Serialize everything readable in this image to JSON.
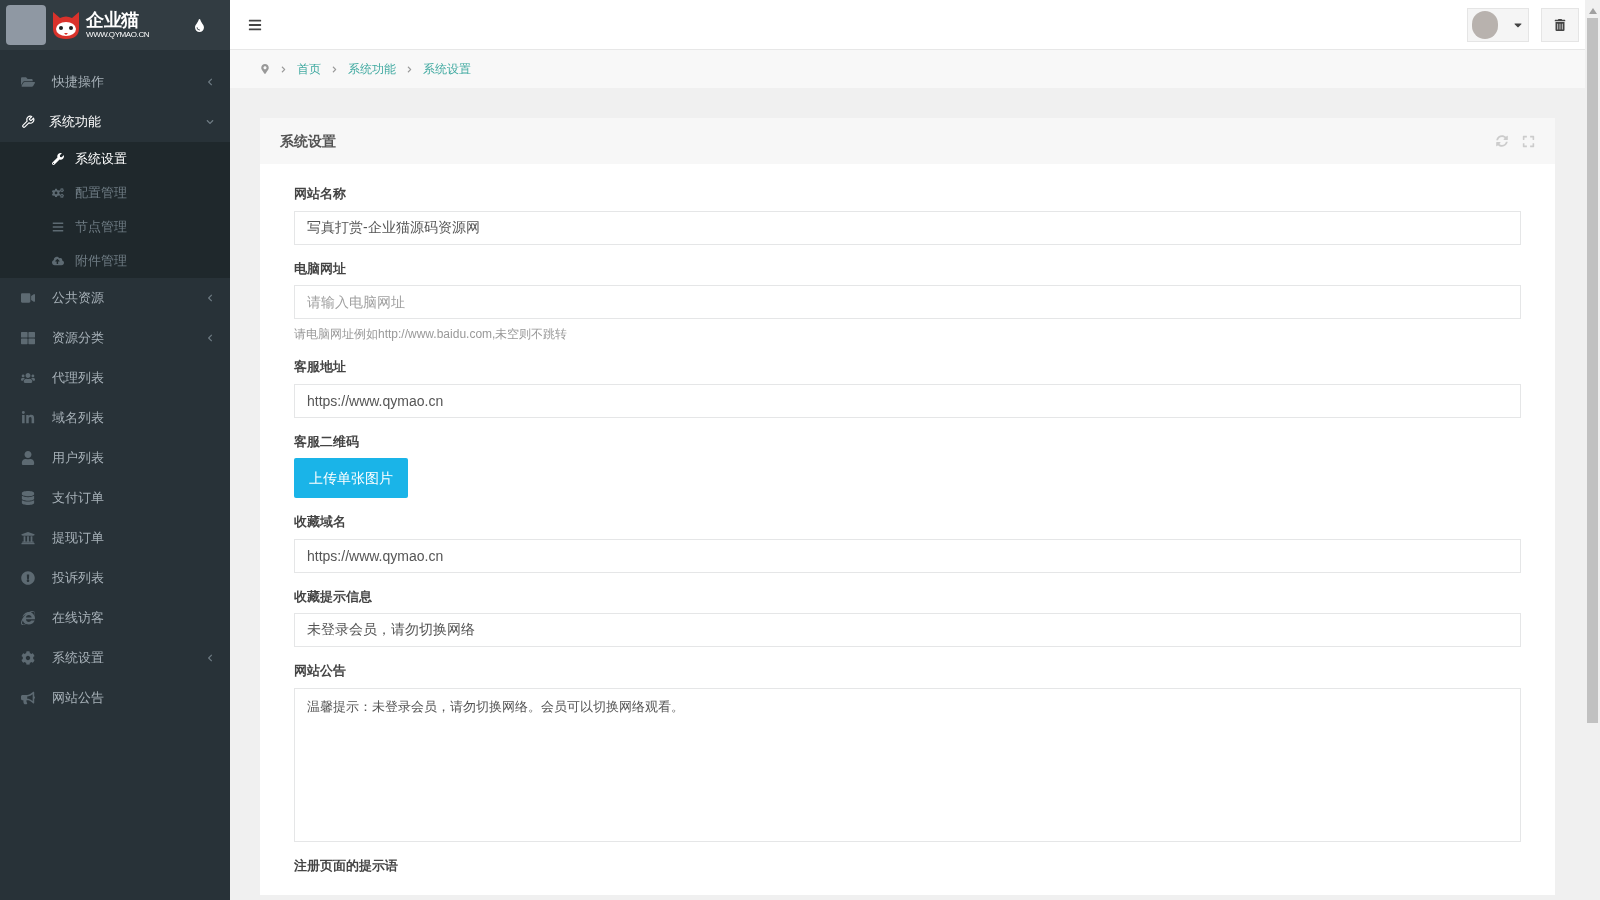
{
  "brand": {
    "name": "企业猫",
    "url": "WWW.QYMAO.CN"
  },
  "sidebar": {
    "items": [
      {
        "label": "快捷操作",
        "expanded": false
      },
      {
        "label": "系统功能",
        "expanded": true,
        "children": [
          {
            "label": "系统设置",
            "selected": true
          },
          {
            "label": "配置管理",
            "selected": false
          },
          {
            "label": "节点管理",
            "selected": false
          },
          {
            "label": "附件管理",
            "selected": false
          }
        ]
      },
      {
        "label": "公共资源",
        "expanded": false
      },
      {
        "label": "资源分类",
        "expanded": false
      },
      {
        "label": "代理列表"
      },
      {
        "label": "域名列表"
      },
      {
        "label": "用户列表"
      },
      {
        "label": "支付订单"
      },
      {
        "label": "提现订单"
      },
      {
        "label": "投诉列表"
      },
      {
        "label": "在线访客"
      },
      {
        "label": "系统设置",
        "expanded": false
      },
      {
        "label": "网站公告"
      }
    ]
  },
  "breadcrumb": [
    "首页",
    "系统功能",
    "系统设置"
  ],
  "card": {
    "title": "系统设置",
    "fields": [
      {
        "kind": "input",
        "label": "网站名称",
        "value": "写真打赏-企业猫源码资源网"
      },
      {
        "kind": "input",
        "label": "电脑网址",
        "placeholder": "请输入电脑网址",
        "help": "请电脑网址例如http://www.baidu.com,未空则不跳转"
      },
      {
        "kind": "input",
        "label": "客服地址",
        "value": "https://www.qymao.cn"
      },
      {
        "kind": "upload",
        "label": "客服二维码",
        "button": "上传单张图片"
      },
      {
        "kind": "input",
        "label": "收藏域名",
        "value": "https://www.qymao.cn"
      },
      {
        "kind": "input",
        "label": "收藏提示信息",
        "value": "未登录会员，请勿切换网络"
      },
      {
        "kind": "textarea",
        "label": "网站公告",
        "value": "温馨提示：未登录会员，请勿切换网络。会员可以切换网络观看。"
      },
      {
        "kind": "label",
        "label": "注册页面的提示语"
      }
    ]
  }
}
